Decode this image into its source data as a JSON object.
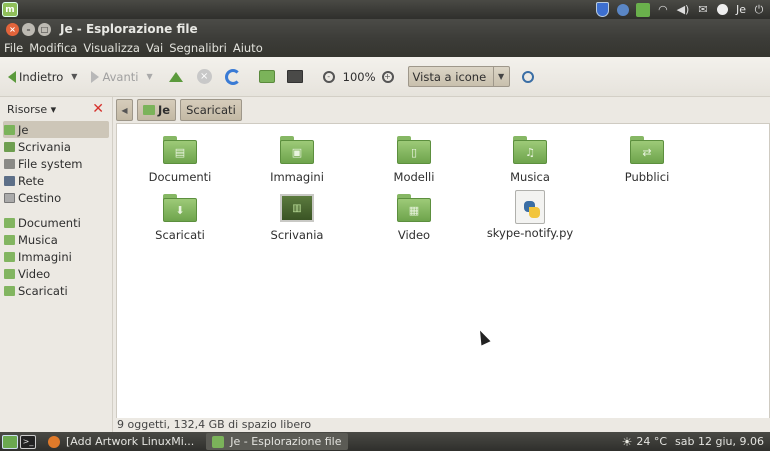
{
  "top_panel": {
    "user": "Je",
    "icons": [
      "mint-menu-icon",
      "shield-icon",
      "globe-icon",
      "update-manager-icon",
      "wifi-icon",
      "volume-icon",
      "mail-icon",
      "user-icon",
      "power-icon"
    ]
  },
  "window": {
    "title": "Je - Esplorazione file",
    "menu": [
      "File",
      "Modifica",
      "Visualizza",
      "Vai",
      "Segnalibri",
      "Aiuto"
    ]
  },
  "toolbar": {
    "back_label": "Indietro",
    "forward_label": "Avanti",
    "zoom_level": "100%",
    "view_mode": "Vista a icone"
  },
  "sidebar": {
    "header": "Risorse",
    "places": [
      {
        "label": "Je",
        "icon": "home-folder-icon",
        "selected": true
      },
      {
        "label": "Scrivania",
        "icon": "desktop-icon"
      },
      {
        "label": "File system",
        "icon": "drive-icon"
      },
      {
        "label": "Rete",
        "icon": "network-icon"
      },
      {
        "label": "Cestino",
        "icon": "trash-icon"
      }
    ],
    "bookmarks": [
      {
        "label": "Documenti",
        "icon": "folder-icon"
      },
      {
        "label": "Musica",
        "icon": "folder-icon"
      },
      {
        "label": "Immagini",
        "icon": "folder-icon"
      },
      {
        "label": "Video",
        "icon": "folder-icon"
      },
      {
        "label": "Scaricati",
        "icon": "folder-icon"
      }
    ]
  },
  "pathbar": {
    "segments": [
      "Je",
      "Scaricati"
    ]
  },
  "files": [
    {
      "label": "Documenti",
      "icon": "documents-folder-icon"
    },
    {
      "label": "Immagini",
      "icon": "pictures-folder-icon"
    },
    {
      "label": "Modelli",
      "icon": "templates-folder-icon"
    },
    {
      "label": "Musica",
      "icon": "music-folder-icon"
    },
    {
      "label": "Pubblici",
      "icon": "public-folder-icon"
    },
    {
      "label": "Scaricati",
      "icon": "downloads-folder-icon"
    },
    {
      "label": "Scrivania",
      "icon": "desktop-folder-icon"
    },
    {
      "label": "Video",
      "icon": "videos-folder-icon"
    },
    {
      "label": "skype-notify.py",
      "icon": "python-file-icon"
    }
  ],
  "statusbar": {
    "text": "9 oggetti, 132,4 GB di spazio libero"
  },
  "bottom_panel": {
    "tasks": [
      {
        "label": "[Add Artwork LinuxMi...",
        "icon": "firefox-icon"
      },
      {
        "label": "Je - Esplorazione file",
        "icon": "file-manager-icon",
        "active": true
      }
    ],
    "weather": "24 °C",
    "datetime": "sab 12 giu, 9.06"
  },
  "colors": {
    "folder_green": "#7bb35a",
    "panel_dark": "#3c3c38",
    "close_red": "#e3643b"
  }
}
